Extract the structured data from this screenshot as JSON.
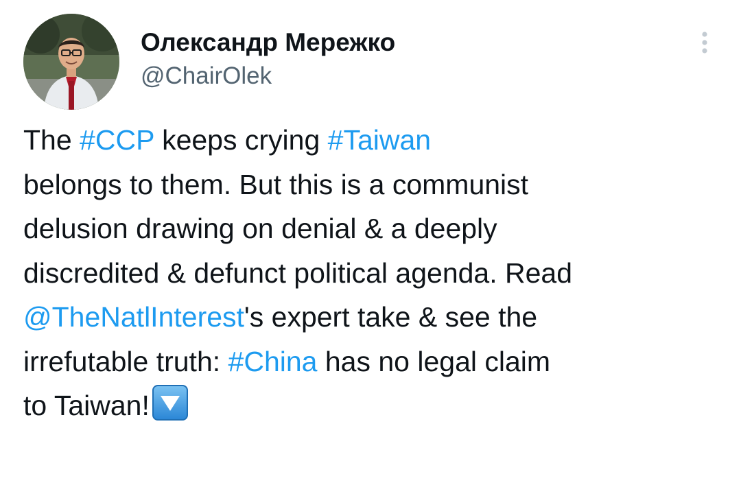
{
  "author": {
    "display_name": "Олександр Мережко",
    "handle": "@ChairOlek"
  },
  "icons": {
    "more": "more-vertical-icon",
    "emoji": "down-arrow-button-emoji"
  },
  "colors": {
    "text": "#0f1419",
    "secondary": "#536471",
    "link": "#1d9bf0",
    "emoji_bg": "#3b9be0"
  },
  "tweet": {
    "lines": [
      [
        {
          "text": "The ",
          "type": "text"
        },
        {
          "text": "#CCP",
          "type": "hashtag"
        },
        {
          "text": " keeps crying ",
          "type": "text"
        },
        {
          "text": "#Taiwan",
          "type": "hashtag"
        }
      ],
      [
        {
          "text": "belongs to them. But this is a communist",
          "type": "text"
        }
      ],
      [
        {
          "text": "delusion drawing on denial & a deeply",
          "type": "text"
        }
      ],
      [
        {
          "text": "discredited & defunct political agenda. Read",
          "type": "text"
        }
      ],
      [
        {
          "text": "@TheNatlInterest",
          "type": "mention"
        },
        {
          "text": "'s expert take & see the",
          "type": "text"
        }
      ],
      [
        {
          "text": "irrefutable truth: ",
          "type": "text"
        },
        {
          "text": "#China",
          "type": "hashtag"
        },
        {
          "text": " has no legal claim",
          "type": "text"
        }
      ],
      [
        {
          "text": "to Taiwan!",
          "type": "text"
        }
      ]
    ]
  }
}
